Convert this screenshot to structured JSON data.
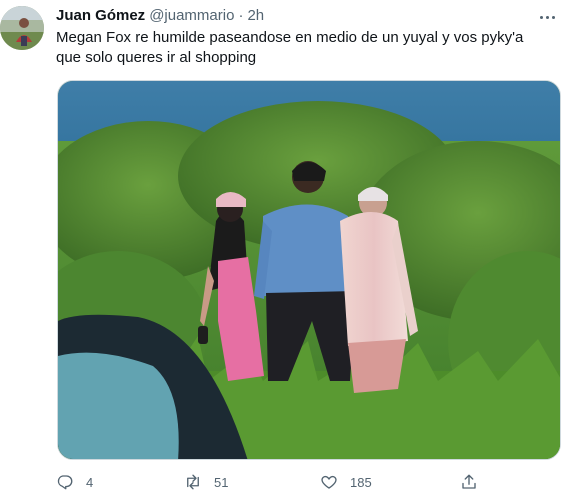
{
  "tweet": {
    "author_name": "Juan Gómez",
    "author_handle": "@juammario",
    "separator": "·",
    "time": "2h",
    "text": "Megan Fox re humilde paseandose en medio de un yuyal y vos pyky'a que solo queres ir al shopping"
  },
  "actions": {
    "reply_count": "4",
    "retweet_count": "51",
    "like_count": "185"
  },
  "icons": {
    "more": "more-icon",
    "reply": "reply-icon",
    "retweet": "retweet-icon",
    "like": "heart-icon",
    "share": "share-icon"
  },
  "colors": {
    "text": "#0f1419",
    "secondary": "#536471",
    "border": "#cfd9de"
  }
}
